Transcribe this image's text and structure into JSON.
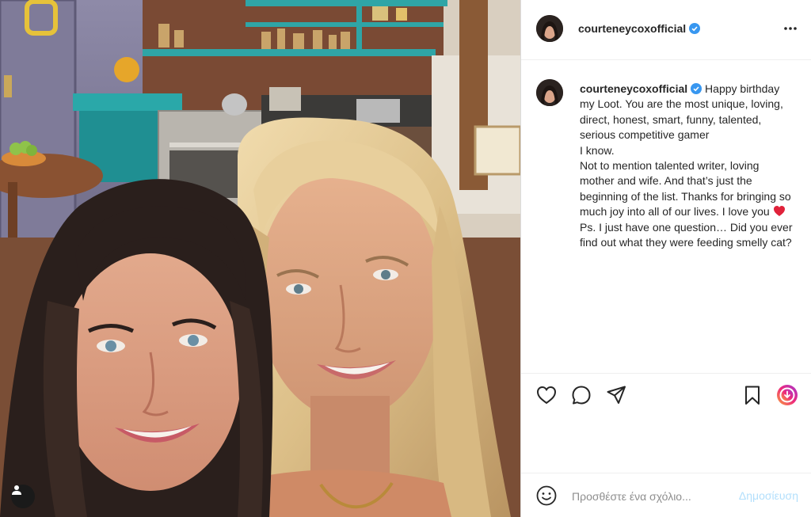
{
  "post": {
    "username": "courteneycoxofficial",
    "verified": true,
    "caption_lines": [
      "Happy birthday my Loot. You are the most unique, loving, direct, honest, smart, funny, talented, serious competitive gamer",
      "I know.",
      "Not to mention talented writer, loving mother and wife. And that’s just the beginning of the list. Thanks for bringing so much joy into all of our lives. I love you",
      "Ps. I just have one question… Did you ever find out what they were feeding smelly cat?"
    ],
    "caption_emoji": "red-heart"
  },
  "header": {
    "more_icon": "more-horizontal-icon"
  },
  "actions": {
    "icons": [
      "heart-icon",
      "comment-icon",
      "share-icon",
      "bookmark-icon",
      "instagram-icon"
    ]
  },
  "comment": {
    "placeholder": "Προσθέστε ένα σχόλιο...",
    "post_label": "Δημοσίευση"
  },
  "colors": {
    "verified_blue": "#3897f0",
    "post_button": "#b2dffc",
    "heart_red": "#ed4956",
    "kitchen_teal": "#2aa8a9"
  }
}
